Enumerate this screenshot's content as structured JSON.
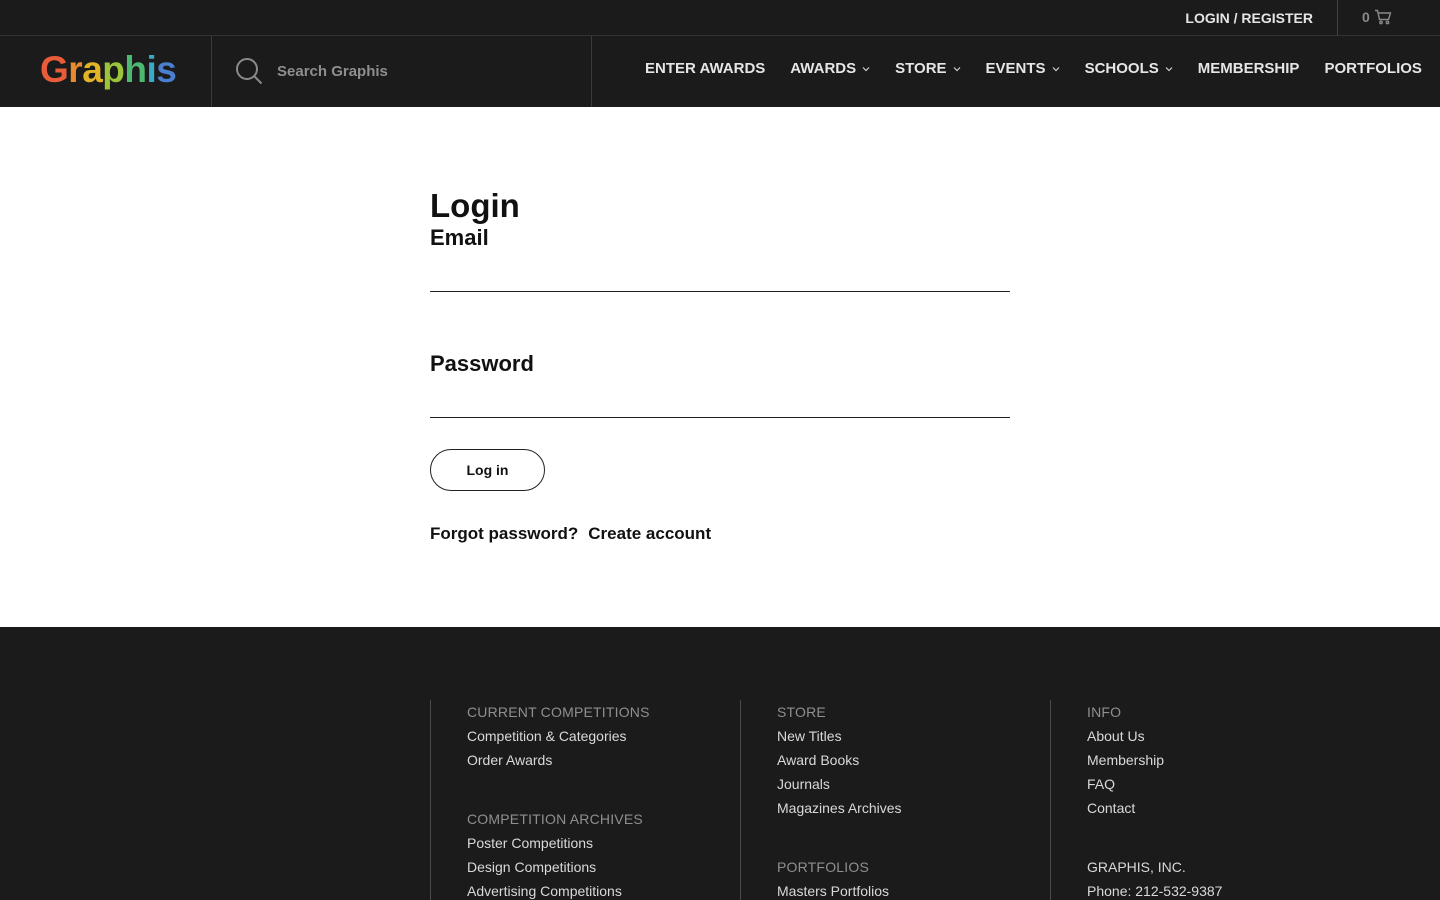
{
  "topbar": {
    "login_register": "LOGIN / REGISTER",
    "cart_count": "0"
  },
  "header": {
    "logo_letters": [
      {
        "char": "G",
        "color": "#e85c3a"
      },
      {
        "char": "r",
        "color": "#e88b2e"
      },
      {
        "char": "a",
        "color": "#e2b526"
      },
      {
        "char": "p",
        "color": "#9cc43a"
      },
      {
        "char": "h",
        "color": "#4cb870"
      },
      {
        "char": "i",
        "color": "#3aa8c8"
      },
      {
        "char": "s",
        "color": "#4a7fd0"
      }
    ],
    "search_placeholder": "Search Graphis",
    "nav": [
      {
        "label": "ENTER AWARDS",
        "dropdown": false
      },
      {
        "label": "AWARDS",
        "dropdown": true
      },
      {
        "label": "STORE",
        "dropdown": true
      },
      {
        "label": "EVENTS",
        "dropdown": true
      },
      {
        "label": "SCHOOLS",
        "dropdown": true
      },
      {
        "label": "MEMBERSHIP",
        "dropdown": false
      },
      {
        "label": "PORTFOLIOS",
        "dropdown": false
      }
    ]
  },
  "main": {
    "title": "Login",
    "email_label": "Email",
    "email_value": "",
    "password_label": "Password",
    "password_value": "",
    "login_button": "Log in",
    "forgot_password": "Forgot password?",
    "create_account": "Create account"
  },
  "footer": {
    "col1": {
      "heading1": "CURRENT COMPETITIONS",
      "links1": [
        "Competition & Categories",
        "Order Awards"
      ],
      "heading2": "COMPETITION ARCHIVES",
      "links2": [
        "Poster Competitions",
        "Design Competitions",
        "Advertising Competitions"
      ]
    },
    "col2": {
      "heading1": "STORE",
      "links1": [
        "New Titles",
        "Award Books",
        "Journals",
        "Magazines Archives"
      ],
      "heading2": "PORTFOLIOS",
      "links2": [
        "Masters Portfolios"
      ]
    },
    "col3": {
      "heading1": "INFO",
      "links1": [
        "About Us",
        "Membership",
        "FAQ",
        "Contact"
      ],
      "company": "GRAPHIS, INC.",
      "phone": "Phone: 212-532-9387"
    }
  },
  "colors": {
    "header_bg": "#1b1b1b",
    "page_bg": "#ffffff",
    "text_dark": "#111111"
  }
}
